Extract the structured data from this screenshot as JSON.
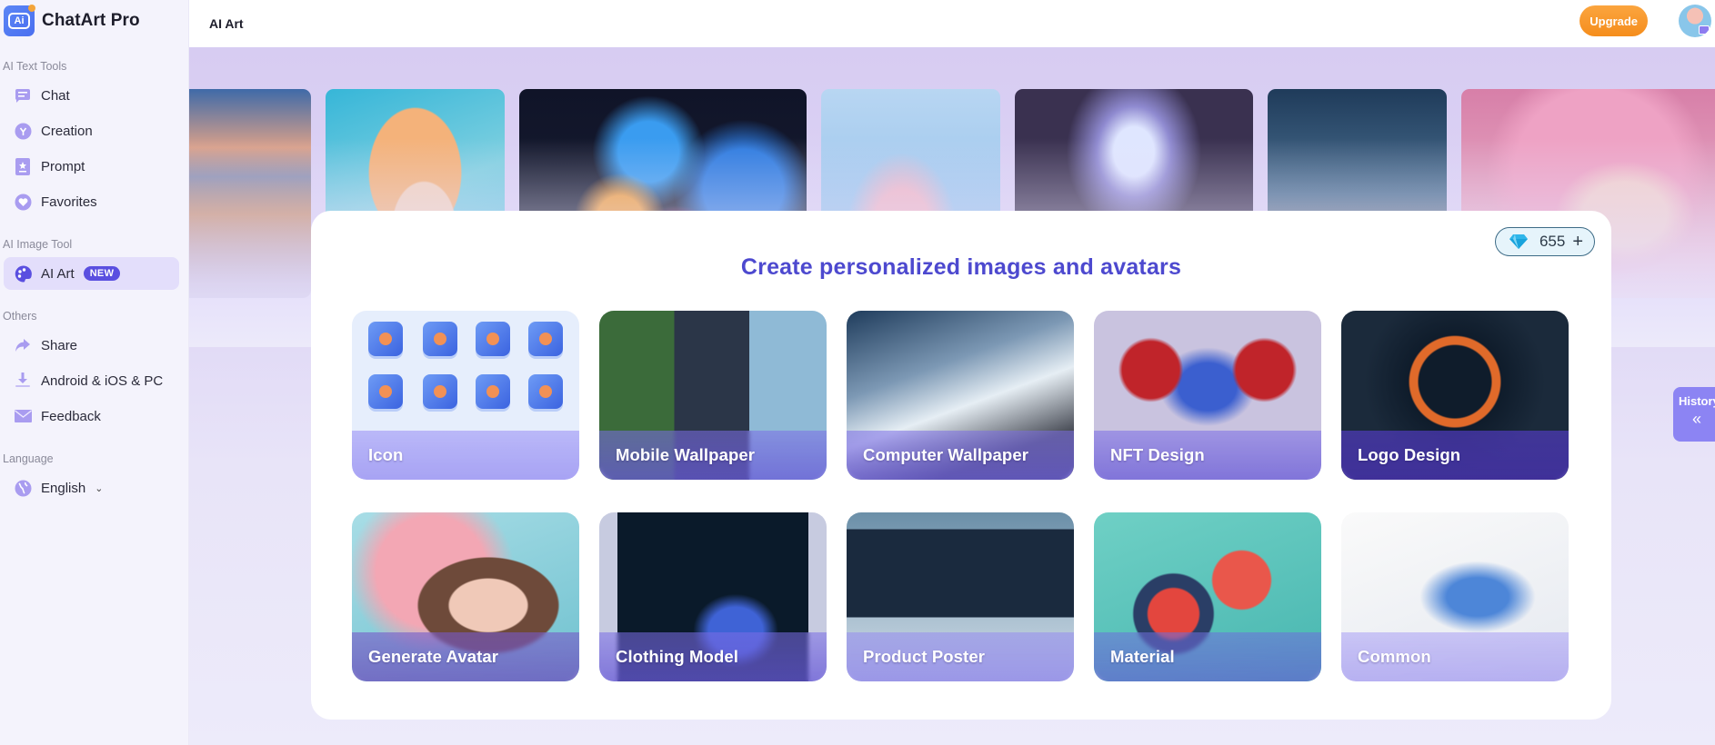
{
  "app": {
    "name": "ChatArt Pro",
    "page_title": "AI Art"
  },
  "header": {
    "upgrade_label": "Upgrade",
    "avatar_icon": "user-avatar"
  },
  "sidebar": {
    "sections": [
      {
        "label": "AI Text Tools",
        "items": [
          {
            "label": "Chat",
            "icon": "chat-icon"
          },
          {
            "label": "Creation",
            "icon": "lightbulb-icon"
          },
          {
            "label": "Prompt",
            "icon": "prompt-icon"
          },
          {
            "label": "Favorites",
            "icon": "heart-icon"
          }
        ]
      },
      {
        "label": "AI Image Tool",
        "items": [
          {
            "label": "AI Art",
            "icon": "palette-icon",
            "badge": "NEW",
            "active": true
          }
        ]
      },
      {
        "label": "Others",
        "items": [
          {
            "label": "Share",
            "icon": "share-icon"
          },
          {
            "label": "Android & iOS & PC",
            "icon": "download-icon"
          },
          {
            "label": "Feedback",
            "icon": "mail-icon"
          }
        ]
      },
      {
        "label": "Language",
        "items": [
          {
            "label": "English",
            "icon": "globe-icon",
            "dropdown": true
          }
        ]
      }
    ]
  },
  "main": {
    "credits": {
      "value": "655",
      "action": "+",
      "icon": "diamond-icon"
    },
    "headline": "Create personalized images and avatars",
    "history_tab": {
      "label": "History",
      "icon": "double-chevron-left-icon"
    },
    "categories": [
      {
        "label": "Icon"
      },
      {
        "label": "Mobile Wallpaper"
      },
      {
        "label": "Computer Wallpaper"
      },
      {
        "label": "NFT Design"
      },
      {
        "label": "Logo Design"
      },
      {
        "label": "Generate Avatar"
      },
      {
        "label": "Clothing Model"
      },
      {
        "label": "Product Poster"
      },
      {
        "label": "Material"
      },
      {
        "label": "Common"
      }
    ],
    "banner_images": [
      "sunset-lake",
      "anime-girl-headphones",
      "glowing-cubes",
      "pink-flower",
      "sci-fi-tunnel",
      "mountain-cabin",
      "pink-hair-girl"
    ]
  },
  "colors": {
    "accent": "#4d49cf",
    "badge": "#5a4fe0",
    "upgrade": "#f7941f",
    "sidebar_active": "#e3defb"
  }
}
